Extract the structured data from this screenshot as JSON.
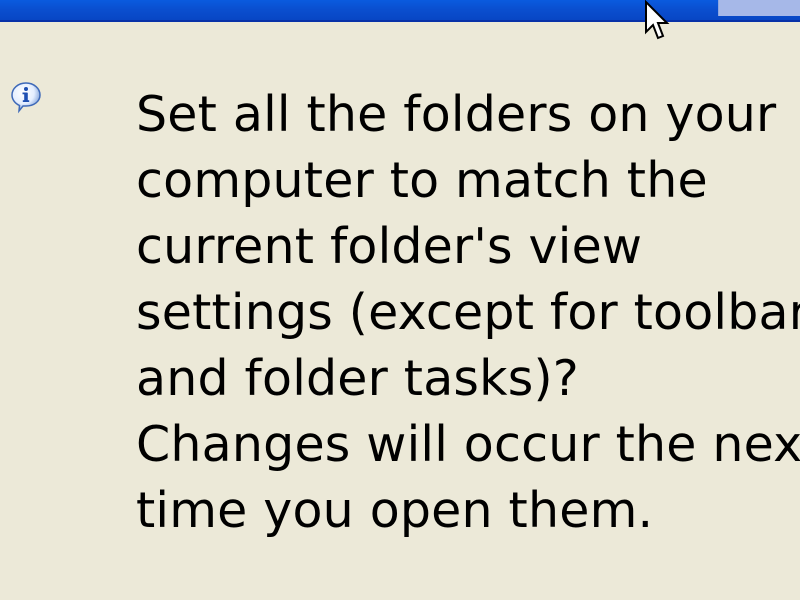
{
  "window": {
    "titlebar_color": "#0A4FD0",
    "background_color": "#ECE9D8"
  },
  "dialog": {
    "icon": "info-icon",
    "message_lines": [
      "Set all the folders on your",
      "computer to match the",
      "current folder's view",
      "settings (except for toolbars",
      "and folder tasks)?",
      "Changes will occur the next",
      "time you open them."
    ]
  },
  "pointer": {
    "icon": "mouse-cursor-icon"
  }
}
